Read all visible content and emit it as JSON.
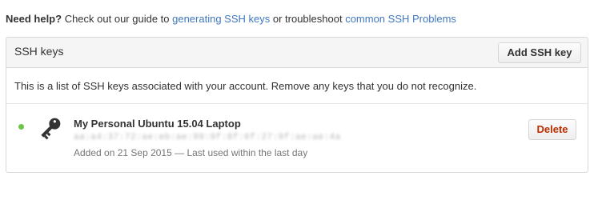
{
  "help": {
    "prefix": "Need help?",
    "text1": " Check out our guide to ",
    "link1": "generating SSH keys",
    "text2": " or troubleshoot ",
    "link2": "common SSH Problems"
  },
  "panel": {
    "title": "SSH keys",
    "add_button": "Add SSH key",
    "description": "This is a list of SSH keys associated with your account. Remove any keys that you do not recognize."
  },
  "keys": [
    {
      "title": "My Personal Ubuntu 15.04 Laptop",
      "fingerprint": "aa:a4:37:72:ae:eb:ae:99:9f:8f:6f:27:9f:ae:ae:4a",
      "meta": "Added on 21 Sep 2015 — Last used within the last day",
      "status_color": "#6cc644",
      "icon": "key-icon",
      "delete_label": "Delete"
    }
  ],
  "colors": {
    "link": "#4078c0",
    "danger": "#bd2c00",
    "active": "#6cc644"
  }
}
